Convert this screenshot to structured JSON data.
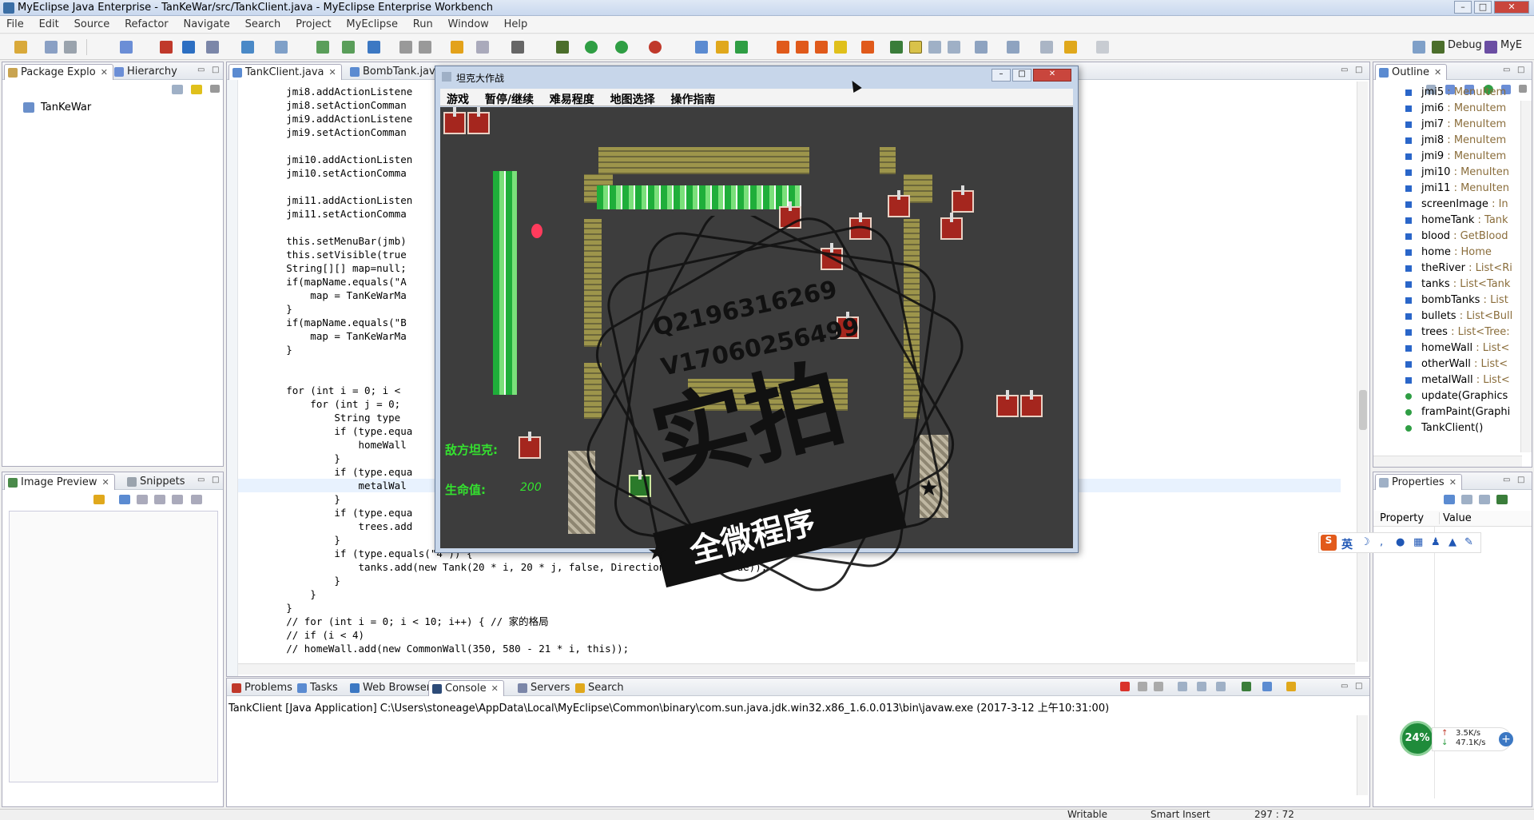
{
  "window": {
    "title": "MyEclipse Java Enterprise - TanKeWar/src/TankClient.java - MyEclipse Enterprise Workbench"
  },
  "menubar": [
    "File",
    "Edit",
    "Source",
    "Refactor",
    "Navigate",
    "Search",
    "Project",
    "MyEclipse",
    "Run",
    "Window",
    "Help"
  ],
  "perspectives": {
    "debug": "Debug",
    "mye": "MyE"
  },
  "package_explorer": {
    "tabs": [
      "Package Explo",
      "Hierarchy"
    ],
    "project": "TanKeWar"
  },
  "image_preview": {
    "tabs": [
      "Image Preview",
      "Snippets"
    ]
  },
  "editor": {
    "tabs": [
      "TankClient.java",
      "BombTank.java"
    ],
    "lines": [
      "        jmi8.addActionListene",
      "        jmi8.setActionComman",
      "        jmi9.addActionListene",
      "        jmi9.setActionComman",
      "",
      "        jmi10.addActionListen",
      "        jmi10.setActionComma",
      "",
      "        jmi11.addActionListen",
      "        jmi11.setActionComma",
      "",
      "        this.setMenuBar(jmb)",
      "        this.setVisible(true",
      "        String[][] map=null;",
      "        if(mapName.equals(\"A",
      "            map = TanKeWarMa",
      "        }",
      "        if(mapName.equals(\"B",
      "            map = TanKeWarMa",
      "        }",
      "",
      "",
      "        for (int i = 0; i <",
      "            for (int j = 0;",
      "                String type",
      "                if (type.equa",
      "                    homeWall",
      "                }",
      "                if (type.equa",
      "                    metalWal",
      "                }",
      "                if (type.equa",
      "                    trees.add",
      "                }",
      "                if (type.equals(\"4\")) {",
      "                    tanks.add(new Tank(20 * i, 20 * j, false, Direction.D, this, true));",
      "                }",
      "            }",
      "        }",
      "        // for (int i = 0; i < 10; i++) { // 家的格局",
      "        // if (i < 4)",
      "        // homeWall.add(new CommonWall(350, 580 - 21 * i, this));"
    ]
  },
  "console": {
    "tabs": [
      "Problems",
      "Tasks",
      "Web Browser",
      "Console",
      "Servers",
      "Search"
    ],
    "line": "TankClient [Java Application] C:\\Users\\stoneage\\AppData\\Local\\MyEclipse\\Common\\binary\\com.sun.java.jdk.win32.x86_1.6.0.013\\bin\\javaw.exe (2017-3-12 上午10:31:00)"
  },
  "outline": {
    "tab": "Outline",
    "items": [
      {
        "name": "jmi5",
        "type": " : MenuItem"
      },
      {
        "name": "jmi6",
        "type": " : MenuItem"
      },
      {
        "name": "jmi7",
        "type": " : MenuItem"
      },
      {
        "name": "jmi8",
        "type": " : MenuItem"
      },
      {
        "name": "jmi9",
        "type": " : MenuItem"
      },
      {
        "name": "jmi10",
        "type": " : MenuIten"
      },
      {
        "name": "jmi11",
        "type": " : MenuIten"
      },
      {
        "name": "screenImage",
        "type": " : In"
      },
      {
        "name": "homeTank",
        "type": " : Tank"
      },
      {
        "name": "blood",
        "type": " : GetBlood"
      },
      {
        "name": "home",
        "type": " : Home"
      },
      {
        "name": "theRiver",
        "type": " : List<Ri"
      },
      {
        "name": "tanks",
        "type": " : List<Tank"
      },
      {
        "name": "bombTanks",
        "type": " : List"
      },
      {
        "name": "bullets",
        "type": " : List<Bull"
      },
      {
        "name": "trees",
        "type": " : List<Tree:"
      },
      {
        "name": "homeWall",
        "type": " : List<"
      },
      {
        "name": "otherWall",
        "type": " : List<"
      },
      {
        "name": "metalWall",
        "type": " : List<"
      },
      {
        "name": "update(Graphics",
        "type": ""
      },
      {
        "name": "framPaint(Graphi",
        "type": ""
      },
      {
        "name": "TankClient()",
        "type": ""
      }
    ]
  },
  "properties": {
    "tab": "Properties",
    "col_property": "Property",
    "col_value": "Value"
  },
  "game": {
    "title": "坦克大作战",
    "menu": [
      "游戏",
      "暂停/继续",
      "难易程度",
      "地图选择",
      "操作指南"
    ],
    "enemy_label": "敌方坦克:",
    "life_label": "生命值:",
    "life_value": "200"
  },
  "watermark": {
    "line1": "Q2196316269",
    "line2": "V17060256499",
    "big": "实拍",
    "banner": "全微程序"
  },
  "ime": {
    "label": "英"
  },
  "net": {
    "percent": "24%",
    "up": "3.5K/s",
    "down": "47.1K/s"
  },
  "status": {
    "writable": "Writable",
    "insert": "Smart Insert",
    "pos": "297 : 72"
  }
}
